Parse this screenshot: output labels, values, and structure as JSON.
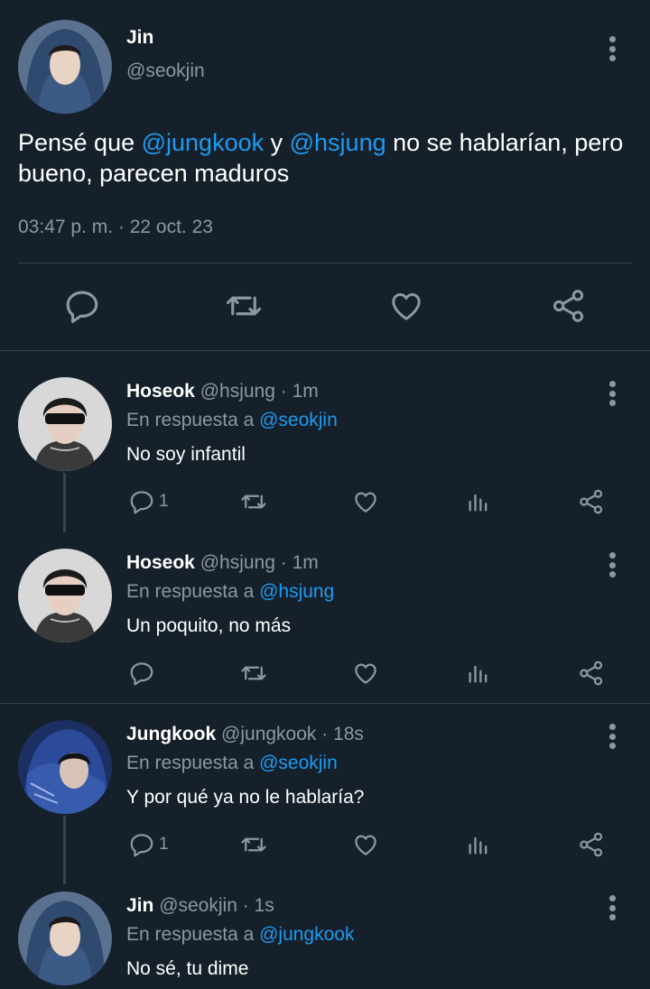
{
  "main_tweet": {
    "name": "Jin",
    "handle": "@seokjin",
    "text_part1": "Pensé que ",
    "mention1": "@jungkook",
    "text_part2": " y ",
    "mention2": "@hsjung",
    "text_part3": " no se hablarían, pero bueno, parecen maduros",
    "timestamp": "03:47 p. m. · 22 oct. 23"
  },
  "replies": [
    {
      "name": "Hoseok",
      "meta": "@hsjung · 1m",
      "in_reply_prefix": "En respuesta a ",
      "in_reply_to": "@seokjin",
      "text": "No soy infantil",
      "reply_count": "1"
    },
    {
      "name": "Hoseok",
      "meta": "@hsjung · 1m",
      "in_reply_prefix": "En respuesta a ",
      "in_reply_to": "@hsjung",
      "text": "Un poquito, no más",
      "reply_count": ""
    },
    {
      "name": "Jungkook",
      "meta": "@jungkook · 18s",
      "in_reply_prefix": "En respuesta a ",
      "in_reply_to": "@seokjin",
      "text": "Y por qué ya no le hablaría?",
      "reply_count": "1"
    },
    {
      "name": "Jin",
      "meta": "@seokjin · 1s",
      "in_reply_prefix": "En respuesta a ",
      "in_reply_to": "@jungkook",
      "text": "No sé, tu dime",
      "reply_count": ""
    }
  ],
  "icons": {
    "reply": "reply-icon",
    "retweet": "retweet-icon",
    "like": "heart-icon",
    "views": "views-icon",
    "share": "share-icon",
    "more": "more-options-icon"
  },
  "colors": {
    "background": "#15202b",
    "accent": "#1d9bf0",
    "muted": "#8b98a5",
    "divider": "#38444d"
  }
}
